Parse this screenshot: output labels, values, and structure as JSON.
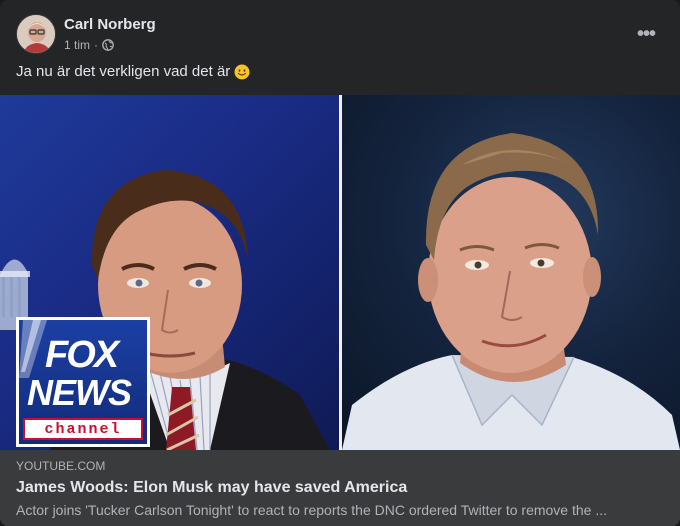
{
  "post": {
    "author": "Carl Norberg",
    "time": "1 tim",
    "separator": "·",
    "audience_icon": "globe-icon",
    "more_icon": "more-horizontal-icon",
    "more_label": "•••",
    "text": "Ja nu är det verkligen vad det är",
    "emoji": "slightly-smiling-face-icon"
  },
  "media": {
    "left_panel": "tucker-carlson-photo",
    "right_panel": "james-woods-photo",
    "logo": {
      "fox": "FOX",
      "news": "NEWS",
      "channel": "channel"
    }
  },
  "link": {
    "domain": "YOUTUBE.COM",
    "title": "James Woods: Elon Musk may have saved America",
    "description": "Actor joins 'Tucker Carlson Tonight' to react to reports the DNC ordered Twitter to remove the ..."
  },
  "colors": {
    "background": "#242526",
    "link_box": "#3a3b3c",
    "text_primary": "#e4e6eb",
    "text_secondary": "#b0b3b8",
    "fox_blue": "#1b3fa3",
    "fox_red": "#c8102e"
  }
}
